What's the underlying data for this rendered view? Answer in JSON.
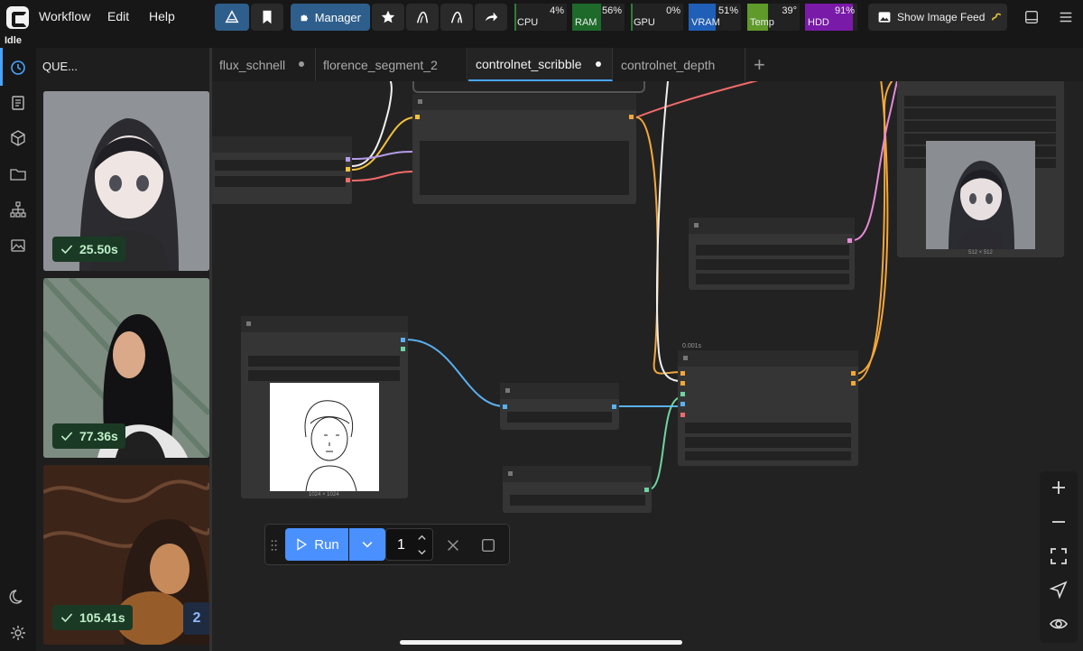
{
  "menu": {
    "workflow": "Workflow",
    "edit": "Edit",
    "help": "Help"
  },
  "toolbar": {
    "manager_label": "Manager",
    "image_feed_label": "Show Image Feed"
  },
  "monitors": [
    {
      "label": "CPU",
      "value": "4%",
      "level": 0.04,
      "color": "#2f7d3a"
    },
    {
      "label": "RAM",
      "value": "56%",
      "level": 0.56,
      "color": "#1d6a2a"
    },
    {
      "label": "GPU",
      "value": "0%",
      "level": 0.0,
      "color": "#2f7d3a"
    },
    {
      "label": "VRAM",
      "value": "51%",
      "level": 0.51,
      "color": "#1f5fb8"
    },
    {
      "label": "Temp",
      "value": "39°",
      "level": 0.39,
      "color": "#5f9a2a"
    },
    {
      "label": "HDD",
      "value": "91%",
      "level": 0.91,
      "color": "#7a1aa8"
    }
  ],
  "status": "Idle",
  "queue": {
    "title": "QUE...",
    "items": [
      {
        "time": "25.50s"
      },
      {
        "time": "77.36s"
      },
      {
        "time": "105.41s"
      }
    ],
    "count": "2"
  },
  "tabs": [
    {
      "label": "flux_schnell"
    },
    {
      "label": "florence_segment_2"
    },
    {
      "label": "controlnet_scribble"
    },
    {
      "label": "controlnet_depth"
    }
  ],
  "canvas": {
    "node_time": "0.001s",
    "input_dims": "1024 × 1024",
    "output_dims": "512 × 512"
  },
  "runbar": {
    "run_label": "Run",
    "batch_count": "1"
  },
  "colors": {
    "accent": "#4a90ff",
    "success": "#1b3a25",
    "link_yellow": "#f3a73a",
    "link_red": "#f06a6a",
    "link_blue": "#5ab0f0",
    "link_green": "#6fd3a0",
    "link_pink": "#e88ad8",
    "link_white": "#f0f0f0"
  }
}
